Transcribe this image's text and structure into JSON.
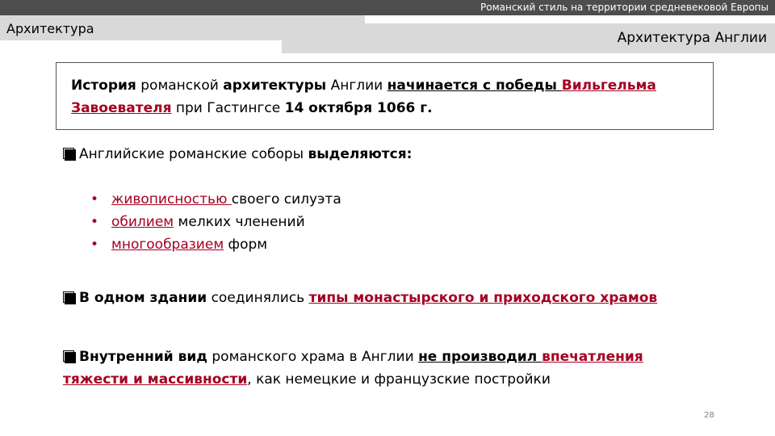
{
  "header": {
    "top_title": "Романский стиль на территории средневековой Европы",
    "section": "Архитектура",
    "subtitle": "Архитектура Англии"
  },
  "intro": {
    "p1": "История",
    "p2": " романской ",
    "p3": "архитектуры",
    "p4": " Англии ",
    "p5": "начинается с победы ",
    "p6": "Вильгельма Завоевателя",
    "p7": " при Гастингсе ",
    "p8": "14 октября 1066 г."
  },
  "point1": {
    "text": "Английские романские соборы ",
    "bold": "выделяются:"
  },
  "sublist": [
    {
      "bullet": "•",
      "emph": "живописностью ",
      "rest": "своего силуэта"
    },
    {
      "bullet": "•",
      "emph": "обилием",
      "rest": " мелких членений"
    },
    {
      "bullet": "•",
      "emph": "многообразием",
      "rest": " форм"
    }
  ],
  "point2": {
    "bold": "В одном здании",
    "text": " соединялись ",
    "emph": "типы монастырского и приходского храмов"
  },
  "point3": {
    "bold": "Внутренний вид",
    "text": " романского храма в Англии ",
    "u1": "не производил ",
    "emph": "впечатления тяжести и массивности",
    "rest": ", как немецкие и французские постройки"
  },
  "page_number": "28",
  "colors": {
    "accent_red": "#a50021",
    "dark_bar": "#4d4d4d",
    "light_bar": "#d9d9d9"
  }
}
